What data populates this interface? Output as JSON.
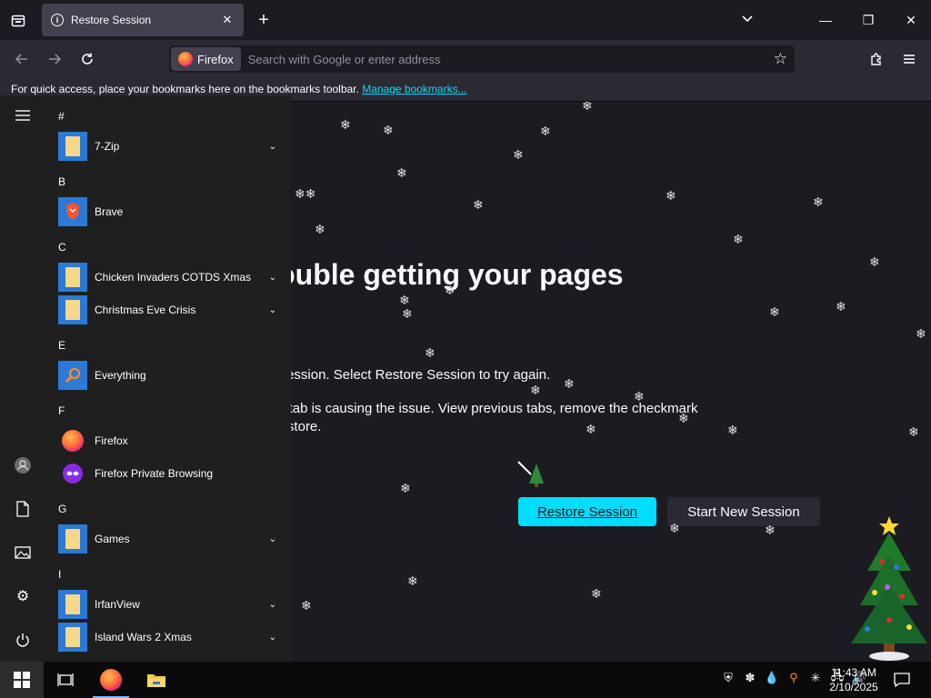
{
  "tab": {
    "title": "Restore Session",
    "close": "✕"
  },
  "newtab": "+",
  "window": {
    "min": "—",
    "max": "❐",
    "close": "✕"
  },
  "urlbar": {
    "identity": "Firefox",
    "placeholder": "Search with Google or enter address"
  },
  "bookmarks": {
    "text": "For quick access, place your bookmarks here on the bookmarks toolbar.",
    "link": "Manage bookmarks..."
  },
  "page": {
    "title": "having trouble getting your pages",
    "desc": "g your last browsing session. Select Restore Session to try again.",
    "hint_line1": "ession? Sometimes a tab is causing the issue. View previous tabs, remove the checkmark",
    "hint_line2": "o recover, and then restore.",
    "restore_btn": "Restore Session",
    "new_btn": "Start New Session"
  },
  "start_menu": {
    "groups": [
      {
        "letter": "#",
        "apps": [
          {
            "name": "7-Zip",
            "icon": "folder-icon",
            "expandable": true
          }
        ]
      },
      {
        "letter": "B",
        "apps": [
          {
            "name": "Brave",
            "icon": "brave-icon",
            "expandable": false
          }
        ]
      },
      {
        "letter": "C",
        "apps": [
          {
            "name": "Chicken Invaders COTDS Xmas",
            "icon": "folder-icon",
            "expandable": true
          },
          {
            "name": "Christmas Eve Crisis",
            "icon": "folder-icon",
            "expandable": true
          }
        ]
      },
      {
        "letter": "E",
        "apps": [
          {
            "name": "Everything",
            "icon": "magnifier-icon",
            "expandable": false
          }
        ]
      },
      {
        "letter": "F",
        "apps": [
          {
            "name": "Firefox",
            "icon": "firefox-icon",
            "expandable": false
          },
          {
            "name": "Firefox Private Browsing",
            "icon": "private-browsing-icon",
            "expandable": false
          }
        ]
      },
      {
        "letter": "G",
        "apps": [
          {
            "name": "Games",
            "icon": "folder-icon",
            "expandable": true
          }
        ]
      },
      {
        "letter": "I",
        "apps": [
          {
            "name": "IrfanView",
            "icon": "folder-icon",
            "expandable": true
          },
          {
            "name": "Island Wars 2 Xmas",
            "icon": "folder-icon",
            "expandable": true
          }
        ]
      }
    ]
  },
  "clock": {
    "time": "11:43 AM",
    "date": "2/10/2025"
  },
  "colors": {
    "accent": "#00ddff",
    "tile": "#2a7ad6",
    "background": "#1c1b22"
  }
}
